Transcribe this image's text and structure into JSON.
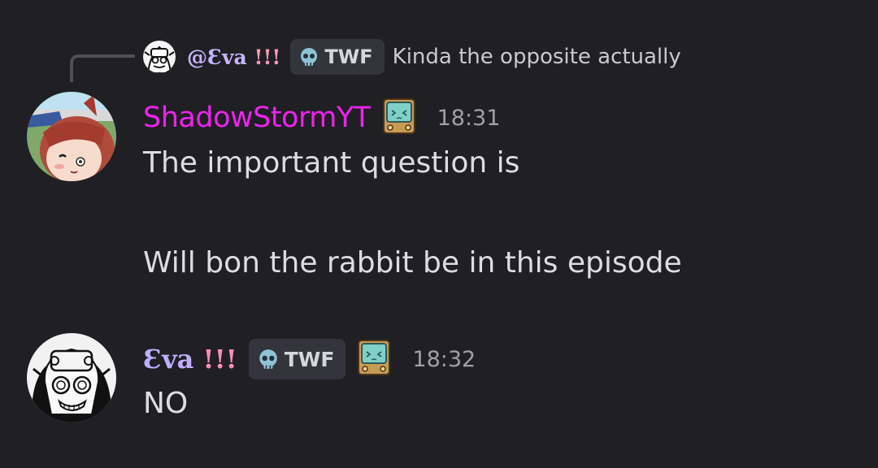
{
  "reply": {
    "username_main": "@Ɛva ",
    "username_bang": "!!!",
    "tag_label": "TWF",
    "text": "Kinda the opposite actually"
  },
  "messages": [
    {
      "username": "ShadowStormYT",
      "timestamp": "18:31",
      "lines": [
        "The important question is",
        "Will bon the rabbit be in this episode"
      ],
      "username_color": "#ee23ee"
    },
    {
      "username_main": "Ɛva ",
      "username_bang": "!!!",
      "tag_label": "TWF",
      "timestamp": "18:32",
      "lines": [
        "NO"
      ],
      "username_color": "#bfaeff"
    }
  ],
  "icons": {
    "tag_icon": "skull-icon",
    "badge_icon": "tv-icon",
    "avatar_1": "anime-avatar",
    "avatar_2": "manga-avatar"
  }
}
